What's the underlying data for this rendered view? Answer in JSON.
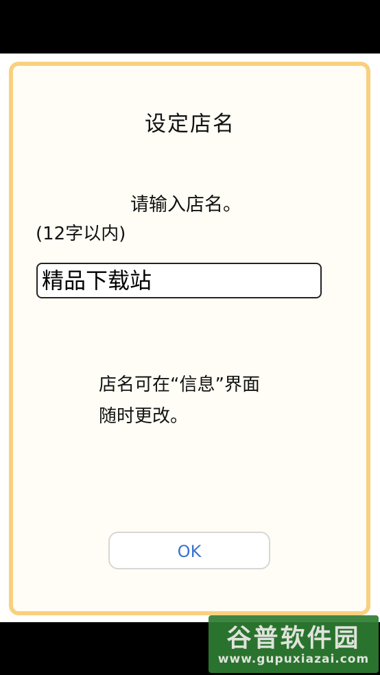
{
  "dialog": {
    "title": "设定店名",
    "prompt_line1": "请输入店名。",
    "prompt_line2": "(12字以内)",
    "input_value": "精品下载站",
    "info_line1": "店名可在“信息”界面",
    "info_line2": "随时更改。",
    "ok_label": "OK"
  },
  "watermark": {
    "brand": "谷普软件园",
    "url": "www.gupuxiazai.com"
  },
  "colors": {
    "dialog_border": "#f9d07e",
    "dialog_background": "#fffdf5",
    "ok_text": "#3a72cc",
    "watermark_bg": "#2e7d32"
  }
}
